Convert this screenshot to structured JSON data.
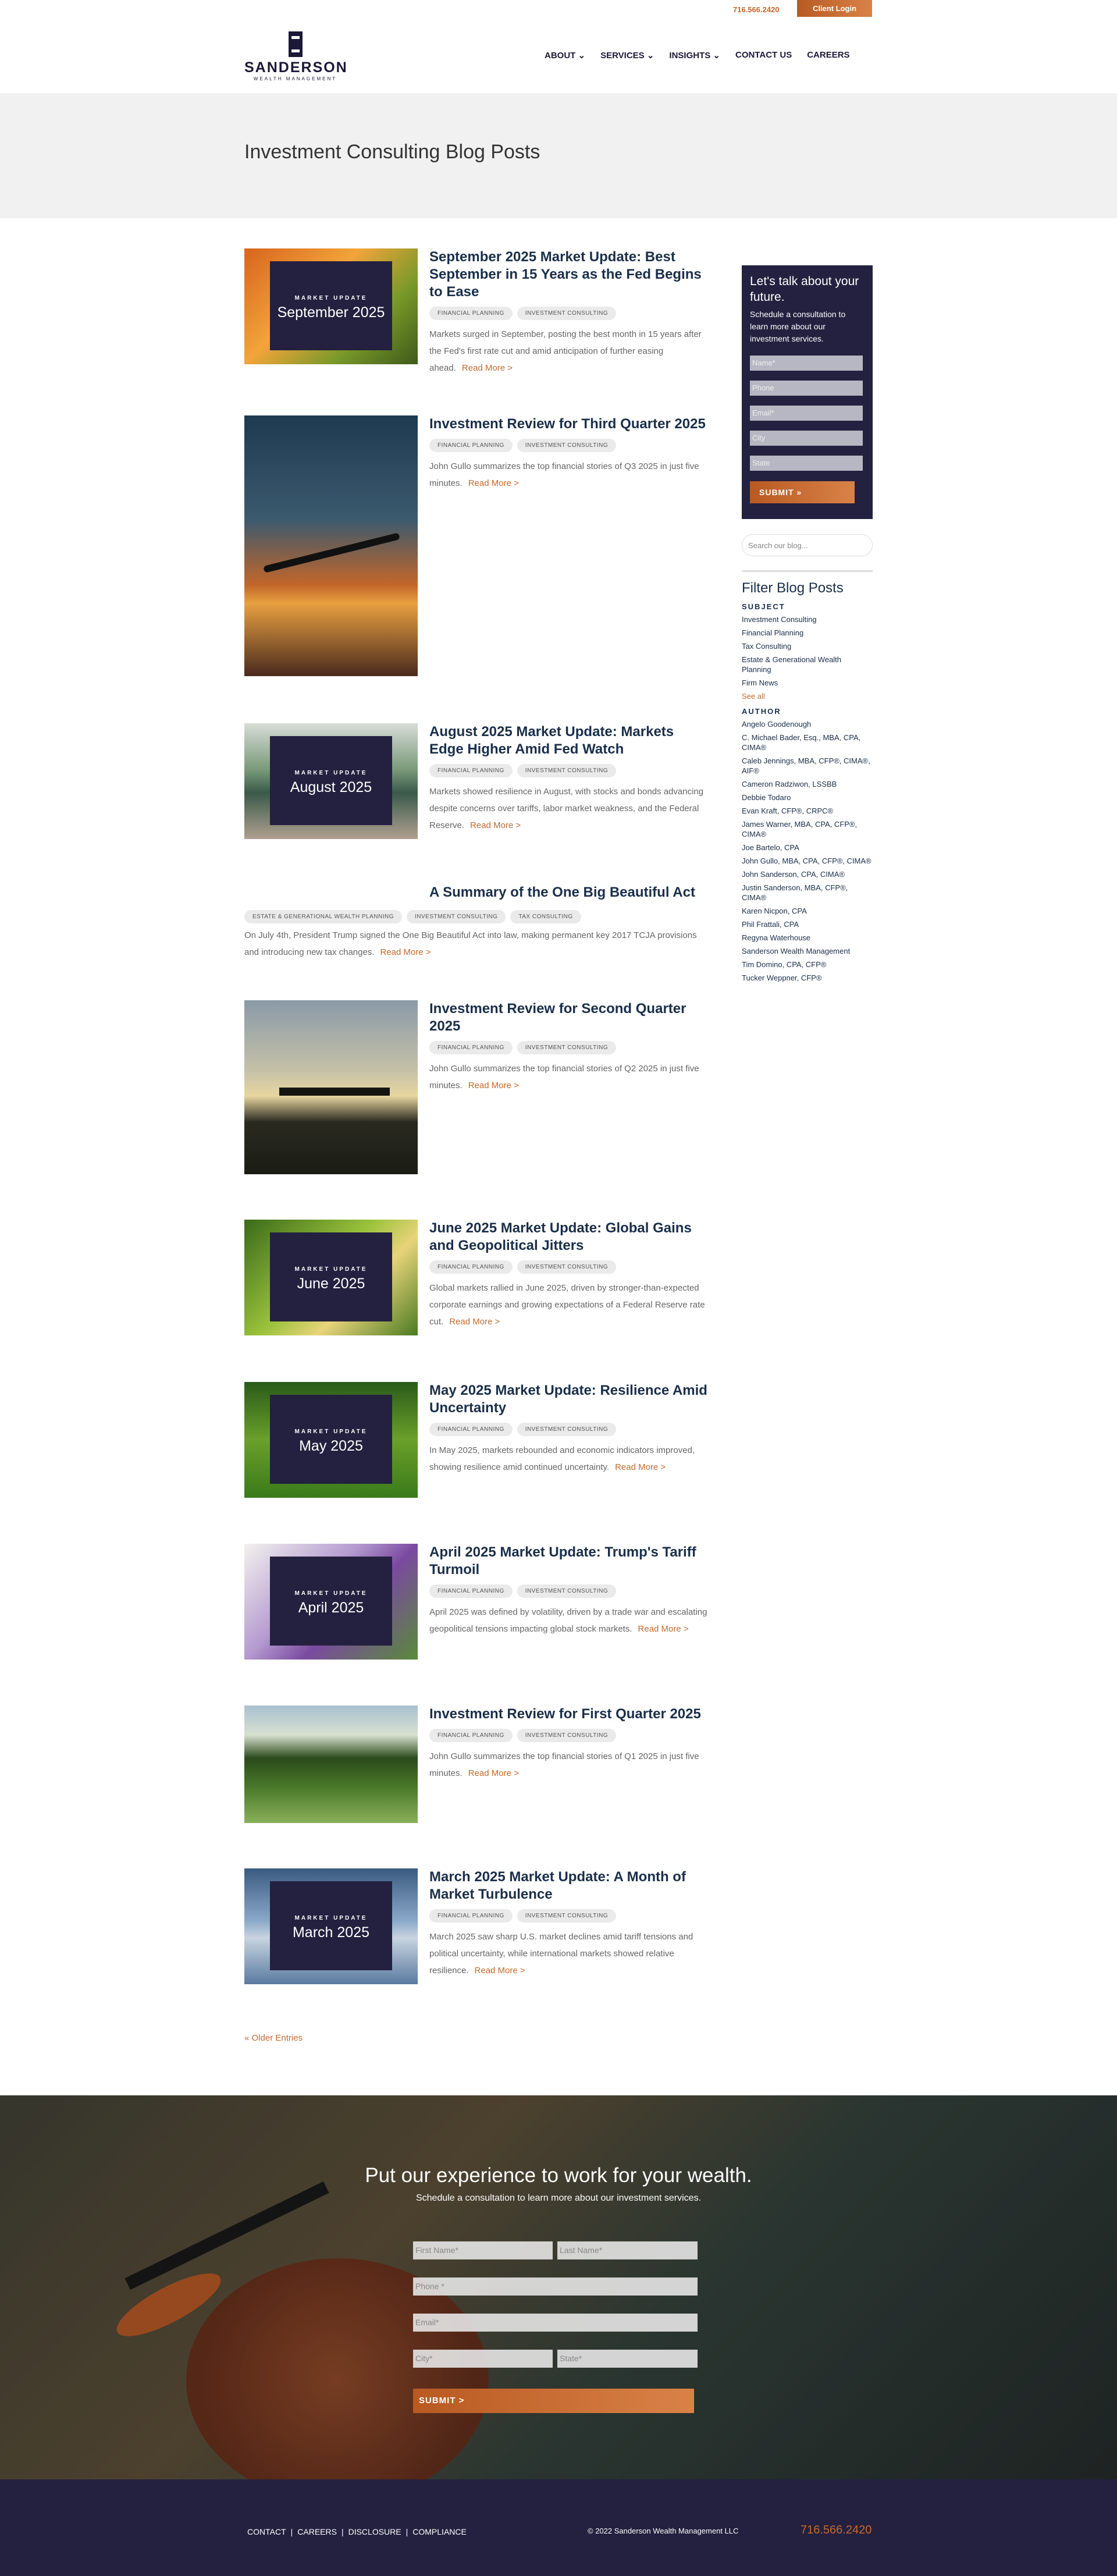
{
  "topbar": {
    "phone": "716.566.2420",
    "client_login": "Client Login"
  },
  "logo": {
    "name": "SANDERSON",
    "subtitle": "WEALTH MANAGEMENT"
  },
  "nav": {
    "about": "ABOUT ⌄",
    "services": "SERVICES ⌄",
    "insights": "INSIGHTS ⌄",
    "contact": "CONTACT US",
    "careers": "CAREERS"
  },
  "hero": {
    "title": "Investment Consulting Blog Posts"
  },
  "posts": [
    {
      "title": "September 2025 Market Update: Best September in 15 Years as the Fed Begins to Ease",
      "tags": [
        "FINANCIAL PLANNING",
        "INVESTMENT CONSULTING"
      ],
      "excerpt": "Markets surged in September, posting the best month in 15 years after the Fed's first rate cut and amid anticipation of further easing ahead.",
      "thumb_kicker": "MARKET UPDATE",
      "thumb_month": "September 2025"
    },
    {
      "title": "Investment Review for Third Quarter 2025",
      "tags": [
        "FINANCIAL PLANNING",
        "INVESTMENT CONSULTING"
      ],
      "excerpt": "John Gullo summarizes the top financial stories of Q3 2025 in just five minutes."
    },
    {
      "title": "August 2025 Market Update: Markets Edge Higher Amid Fed Watch",
      "tags": [
        "FINANCIAL PLANNING",
        "INVESTMENT CONSULTING"
      ],
      "excerpt": "Markets showed resilience in August, with stocks and bonds advancing despite concerns over tariffs, labor market weakness, and the Federal Reserve.",
      "thumb_kicker": "MARKET UPDATE",
      "thumb_month": "August 2025"
    },
    {
      "title": "A Summary of the One Big Beautiful Act",
      "tags": [
        "ESTATE & GENERATIONAL WEALTH PLANNING",
        "INVESTMENT CONSULTING",
        "TAX CONSULTING"
      ],
      "excerpt": "On July 4th, President Trump signed the One Big Beautiful Act into law, making permanent key 2017 TCJA provisions and introducing new tax changes."
    },
    {
      "title": "Investment Review for Second Quarter 2025",
      "tags": [
        "FINANCIAL PLANNING",
        "INVESTMENT CONSULTING"
      ],
      "excerpt": "John Gullo summarizes the top financial stories of Q2 2025 in just five minutes."
    },
    {
      "title": "June 2025 Market Update: Global Gains and Geopolitical Jitters",
      "tags": [
        "FINANCIAL PLANNING",
        "INVESTMENT CONSULTING"
      ],
      "excerpt": "Global markets rallied in June 2025, driven by stronger-than-expected corporate earnings and growing expectations of a Federal Reserve rate cut.",
      "thumb_kicker": "MARKET UPDATE",
      "thumb_month": "June 2025"
    },
    {
      "title": "May 2025 Market Update: Resilience Amid Uncertainty",
      "tags": [
        "FINANCIAL PLANNING",
        "INVESTMENT CONSULTING"
      ],
      "excerpt": "In May 2025, markets rebounded and economic indicators improved, showing resilience amid continued uncertainty.",
      "thumb_kicker": "MARKET UPDATE",
      "thumb_month": "May 2025"
    },
    {
      "title": "April 2025 Market Update: Trump's Tariff Turmoil",
      "tags": [
        "FINANCIAL PLANNING",
        "INVESTMENT CONSULTING"
      ],
      "excerpt": "April 2025 was defined by volatility, driven by a trade war and escalating geopolitical tensions impacting global stock markets.",
      "thumb_kicker": "MARKET UPDATE",
      "thumb_month": "April 2025"
    },
    {
      "title": "Investment Review for First Quarter 2025",
      "tags": [
        "FINANCIAL PLANNING",
        "INVESTMENT CONSULTING"
      ],
      "excerpt": "John Gullo summarizes the top financial stories of Q1 2025 in just five minutes."
    },
    {
      "title": "March 2025 Market Update: A Month of Market Turbulence",
      "tags": [
        "FINANCIAL PLANNING",
        "INVESTMENT CONSULTING"
      ],
      "excerpt": "March 2025 saw sharp U.S. market declines amid tariff tensions and political uncertainty, while international markets showed relative resilience.",
      "thumb_kicker": "MARKET UPDATE",
      "thumb_month": "March 2025"
    }
  ],
  "read_more": "Read More >",
  "older_entries": "« Older Entries",
  "sidebar": {
    "cta_title": "Let's talk about your future.",
    "cta_text": "Schedule a consultation to learn more about our investment services.",
    "fields": [
      "Name*",
      "Phone",
      "Email*",
      "City",
      "State"
    ],
    "submit": "SUBMIT »",
    "search_placeholder": "Search our blog...",
    "filter_title": "Filter Blog Posts",
    "subject_heading": "SUBJECT",
    "subjects": [
      "Investment Consulting",
      "Financial Planning",
      "Tax Consulting",
      "Estate & Generational Wealth Planning",
      "Firm News"
    ],
    "see_all": "See all",
    "author_heading": "AUTHOR",
    "authors": [
      "Angelo Goodenough",
      "C. Michael Bader, Esq., MBA, CPA, CIMA®",
      "Caleb Jennings, MBA, CFP®, CIMA®, AIF®",
      "Cameron Radziwon, LSSBB",
      "Debbie Todaro",
      "Evan Kraft, CFP®, CRPC®",
      "James Warner, MBA, CPA, CFP®, CIMA®",
      "Joe Bartelo, CPA",
      "John Gullo, MBA, CPA, CFP®, CIMA®",
      "John Sanderson, CPA, CIMA®",
      "Justin Sanderson, MBA, CFP®, CIMA®",
      "Karen Nicpon, CPA",
      "Phil Frattali, CPA",
      "Regyna Waterhouse",
      "Sanderson Wealth Management",
      "Tim Domino, CPA, CFP®",
      "Tucker Weppner, CFP®"
    ]
  },
  "cta_section": {
    "title": "Put our experience to work for your wealth.",
    "subtitle": "Schedule a consultation to learn more about our investment services.",
    "first_name": "First Name*",
    "last_name": "Last Name*",
    "phone": "Phone *",
    "email": "Email*",
    "city": "City*",
    "state": "State*",
    "submit": "SUBMIT >"
  },
  "footer": {
    "links": [
      "CONTACT",
      "CAREERS",
      "DISCLOSURE",
      "COMPLIANCE"
    ],
    "separator": "|",
    "copyright": "© 2022 Sanderson Wealth Management LLC",
    "phone": "716.566.2420"
  }
}
